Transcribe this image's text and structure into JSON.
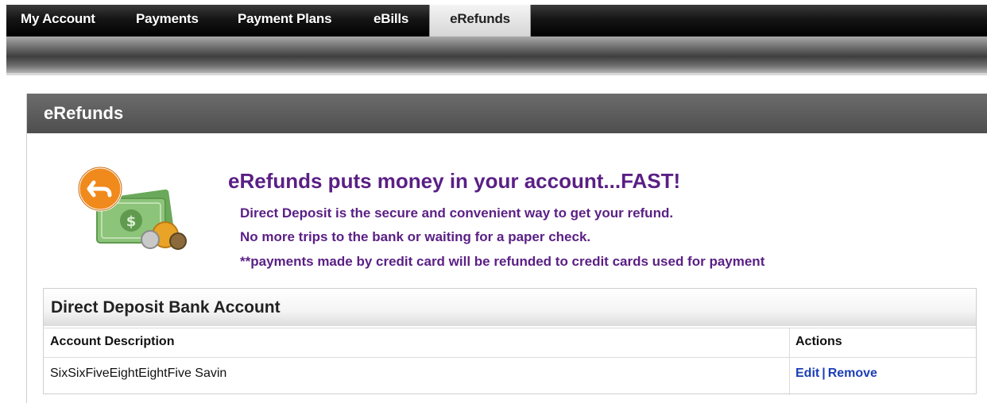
{
  "nav": {
    "tabs": [
      {
        "label": "My Account"
      },
      {
        "label": "Payments"
      },
      {
        "label": "Payment Plans"
      },
      {
        "label": "eBills"
      },
      {
        "label": "eRefunds",
        "active": true
      }
    ]
  },
  "panel": {
    "title": "eRefunds"
  },
  "promo": {
    "icon": "refund-money-icon",
    "headline": "eRefunds puts money in your account...FAST!",
    "lines": [
      "Direct Deposit is the secure and convenient way to get your refund.",
      "No more trips to the bank or waiting for a paper check.",
      "**payments made by credit card will be refunded to credit cards used for payment"
    ]
  },
  "bank_account": {
    "title": "Direct Deposit Bank Account",
    "columns": [
      "Account Description",
      "Actions"
    ],
    "rows": [
      {
        "description": "SixSixFiveEightEightFive Savin",
        "edit": "Edit",
        "separator": "|",
        "remove": "Remove"
      }
    ]
  },
  "colors": {
    "accent_purple": "#5a1f85",
    "link_blue": "#1b3fb5"
  }
}
